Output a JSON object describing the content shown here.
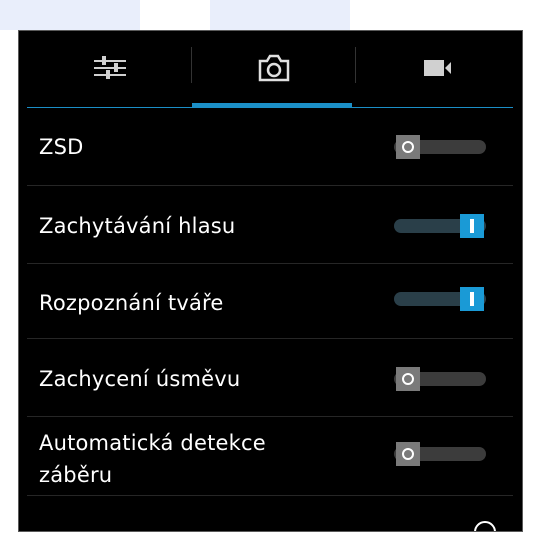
{
  "tabs": [
    {
      "icon": "sliders-icon",
      "active": false
    },
    {
      "icon": "camera-icon",
      "active": true
    },
    {
      "icon": "video-camera-icon",
      "active": false
    }
  ],
  "settings": [
    {
      "label": "ZSD",
      "state": "off"
    },
    {
      "label": "Zachytávání hlasu",
      "state": "on"
    },
    {
      "label": "Rozpoznání tváře",
      "state": "on"
    },
    {
      "label": "Zachycení úsměvu",
      "state": "off"
    },
    {
      "label": "Automatická detekce",
      "label2": "záběru",
      "state": "off"
    }
  ],
  "colors": {
    "accent": "#1b8fc7",
    "toggle_on": "#1a9ad6",
    "toggle_off": "#7a7a7a",
    "background": "#000000",
    "text": "#ffffff"
  }
}
